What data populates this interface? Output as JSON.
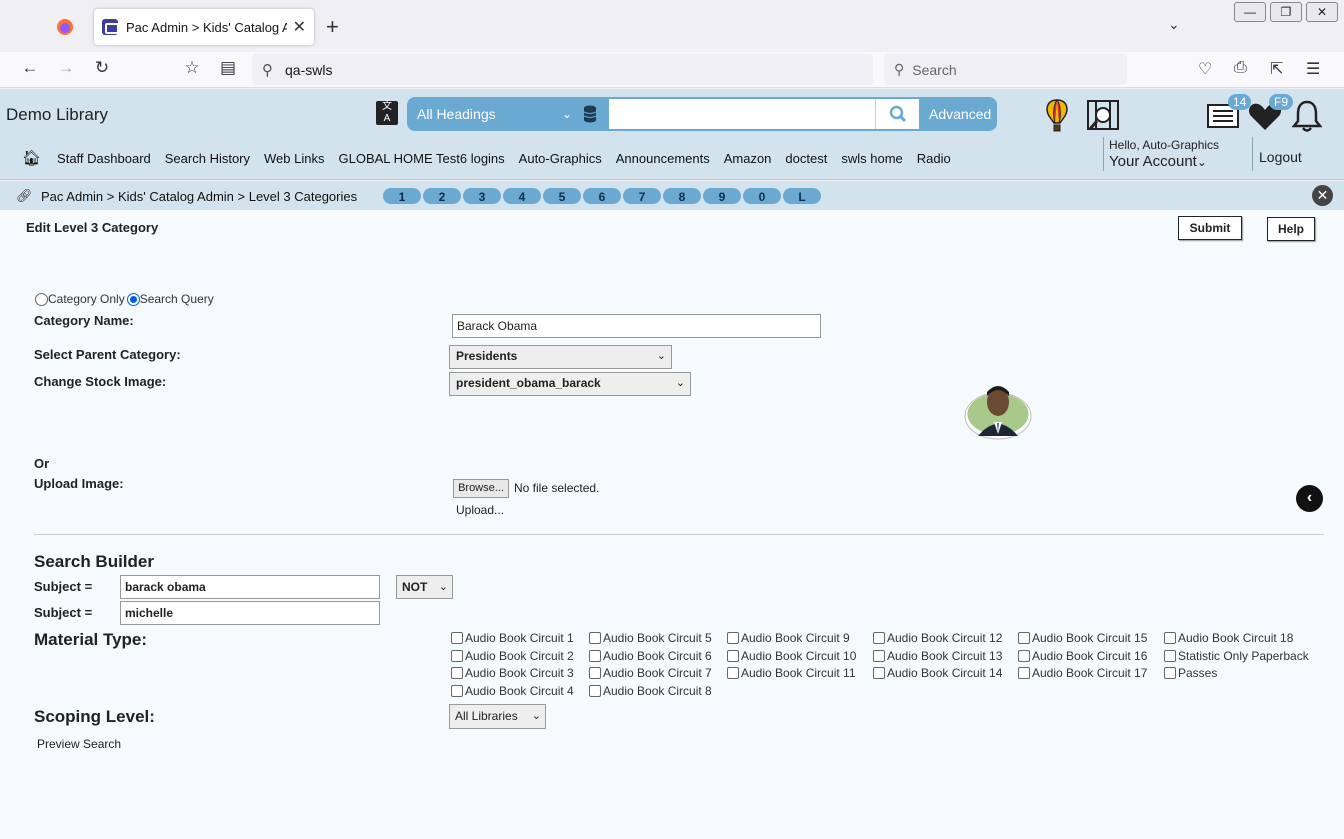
{
  "browser": {
    "tab_title": "Pac Admin > Kids' Catalog Adm",
    "url": "qa-swls",
    "search_placeholder": "Search",
    "min_label": "—",
    "restore_label": "❐",
    "close_label": "✕"
  },
  "header": {
    "library_name": "Demo Library",
    "heading_select": "All Headings",
    "advanced_label": "Advanced",
    "list_badge": "14",
    "fav_badge": "F9",
    "hello_text": "Hello, Auto-Graphics",
    "account_label": "Your Account",
    "logout_label": "Logout"
  },
  "menu": {
    "items": [
      "Staff Dashboard",
      "Search History",
      "Web Links",
      "GLOBAL HOME Test6 logins",
      "Auto-Graphics",
      "Announcements",
      "Amazon",
      "doctest",
      "swls home",
      "Radio"
    ]
  },
  "breadcrumb": {
    "path": "Pac Admin > Kids' Catalog Admin > Level 3 Categories",
    "pages": [
      "1",
      "2",
      "3",
      "4",
      "5",
      "6",
      "7",
      "8",
      "9",
      "0",
      "L"
    ]
  },
  "form": {
    "title": "Edit Level 3 Category",
    "submit_label": "Submit",
    "help_label": "Help",
    "radio_category_only": "Category Only",
    "radio_search_query": "Search Query",
    "category_name_label": "Category Name:",
    "category_name_value": "Barack Obama",
    "parent_label": "Select Parent Category:",
    "parent_value": "Presidents",
    "stock_image_label": "Change Stock Image:",
    "stock_image_value": "president_obama_barack",
    "or_label": "Or",
    "upload_label": "Upload Image:",
    "browse_label": "Browse...",
    "no_file_text": "No file selected.",
    "upload_link": "Upload...",
    "search_builder_title": "Search Builder",
    "subject1_label": "Subject =",
    "subject1_value": "barack obama",
    "operator_value": "NOT",
    "subject2_label": "Subject =",
    "subject2_value": "michelle",
    "material_type_label": "Material Type:",
    "material_types": [
      [
        "Audio Book Circuit 1",
        "Audio Book Circuit 2",
        "Audio Book Circuit 3",
        "Audio Book Circuit 4"
      ],
      [
        "Audio Book Circuit 5",
        "Audio Book Circuit 6",
        "Audio Book Circuit 7",
        "Audio Book Circuit 8"
      ],
      [
        "Audio Book Circuit 9",
        "Audio Book Circuit 10",
        "Audio Book Circuit 11"
      ],
      [
        "Audio Book Circuit 12",
        "Audio Book Circuit 13",
        "Audio Book Circuit 14"
      ],
      [
        "Audio Book Circuit 15",
        "Audio Book Circuit 16",
        "Audio Book Circuit 17"
      ],
      [
        "Audio Book Circuit 18",
        "Statistic Only Paperback",
        "Passes"
      ]
    ],
    "scoping_label": "Scoping Level:",
    "scoping_value": "All Libraries",
    "preview_label": "Preview Search"
  }
}
